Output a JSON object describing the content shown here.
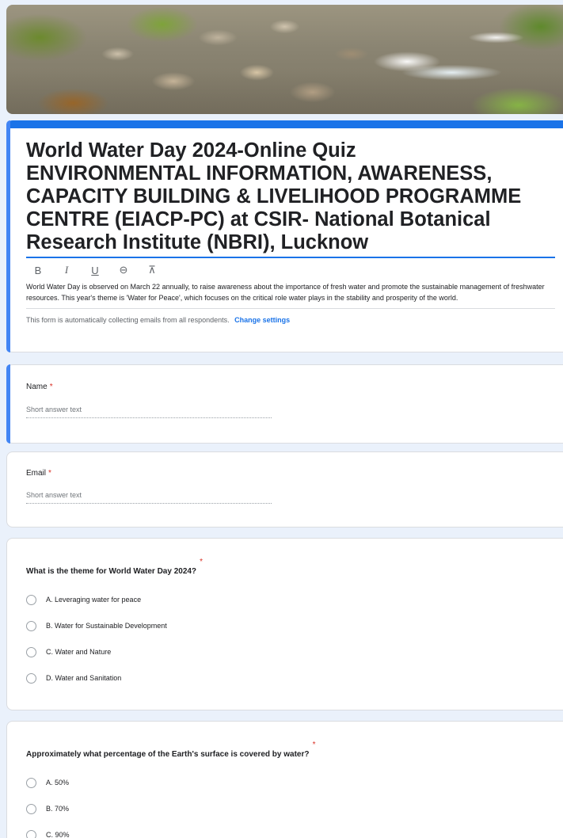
{
  "banner": {
    "alt": "River with rocks and greenery"
  },
  "form": {
    "title": "World Water Day 2024-Online Quiz\nENVIRONMENTAL INFORMATION, AWARENESS,\nCAPACITY BUILDING & LIVELIHOOD PROGRAMME\nCENTRE (EIACP-PC) at CSIR- National Botanical\nResearch Institute (NBRI), Lucknow",
    "toolbar": {
      "bold": "B",
      "italic": "I",
      "underline": "U",
      "link": "⊖",
      "clear": "⊼"
    },
    "description": "World Water Day is observed on March 22 annually, to raise awareness about the importance of fresh water and promote the sustainable management of freshwater resources. This year's theme is 'Water for Peace', which focuses on the critical role water plays in the stability and prosperity of the world.",
    "collect_notice": "This form is automatically collecting emails from all respondents.",
    "change_settings": "Change settings"
  },
  "questions": [
    {
      "label": "Name",
      "required": "*",
      "placeholder": "Short answer text"
    },
    {
      "label": "Email",
      "required": "*",
      "placeholder": "Short answer text"
    },
    {
      "title": "What is the theme for World Water Day 2024?",
      "required": "*",
      "options": [
        "A. Leveraging water for peace",
        "B. Water for Sustainable Development",
        "C. Water and Nature",
        "D. Water and Sanitation"
      ]
    },
    {
      "title": "Approximately what percentage of the Earth's surface is covered by water?",
      "required": "*",
      "options": [
        "A. 50%",
        "B. 70%",
        "C. 90%"
      ]
    }
  ],
  "colors": {
    "accent": "#1a73e8",
    "accent_bar": "#4285f4",
    "required": "#d93025",
    "background": "#eaf1fb"
  }
}
